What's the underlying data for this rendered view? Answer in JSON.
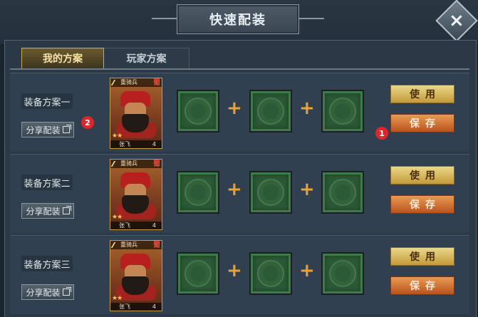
{
  "window": {
    "title": "快速配装",
    "close_icon": "close-icon"
  },
  "tabs": [
    {
      "label": "我的方案",
      "active": true
    },
    {
      "label": "玩家方案",
      "active": false
    }
  ],
  "buttons": {
    "share": "分享配装",
    "use": "使用",
    "save": "保存"
  },
  "plans": [
    {
      "label": "装备方案一",
      "hero": {
        "type": "重骑兵",
        "faction": "蜀",
        "stars": "★★",
        "name": "张飞",
        "level": "4"
      }
    },
    {
      "label": "装备方案二",
      "hero": {
        "type": "重骑兵",
        "faction": "蜀",
        "stars": "★★",
        "name": "张飞",
        "level": "4"
      }
    },
    {
      "label": "装备方案三",
      "hero": {
        "type": "重骑兵",
        "faction": "蜀",
        "stars": "★★",
        "name": "张飞",
        "level": "4"
      }
    }
  ],
  "slots": {
    "plus_symbol": "+"
  },
  "markers": {
    "one": "1",
    "two": "2"
  },
  "colors": {
    "accent_gold": "#c49a3a",
    "save_orange": "#b9521e",
    "slot_green": "#2b5a36",
    "marker_red": "#e0262a"
  }
}
